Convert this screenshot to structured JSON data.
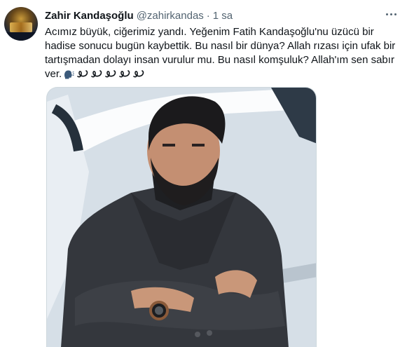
{
  "tweet": {
    "author_name": "Zahir Kandaşoğlu",
    "handle": "@zahirkandas",
    "separator": "·",
    "time": "1 sa",
    "text_lines": [
      "Acımız büyük, ciğerimiz yandı. Yeğenim Fatih Kandaşoğlu'nu üzücü bir",
      "hadise sonucu bugün kaybettik. Bu nasıl bir dünya? Allah rızası için ufak bir",
      "tartışmadan dolayı insan vurulur mu. Bu nasıl komşuluk?  Allah'ım sen sabır",
      "ver."
    ],
    "emoji_icons": [
      "speaking-head-emoji",
      "loop-emoji",
      "loop-emoji",
      "loop-emoji",
      "loop-emoji",
      "loop-emoji"
    ]
  },
  "colors": {
    "text": "#0f1419",
    "secondary": "#536471",
    "border": "#cfd9de"
  }
}
